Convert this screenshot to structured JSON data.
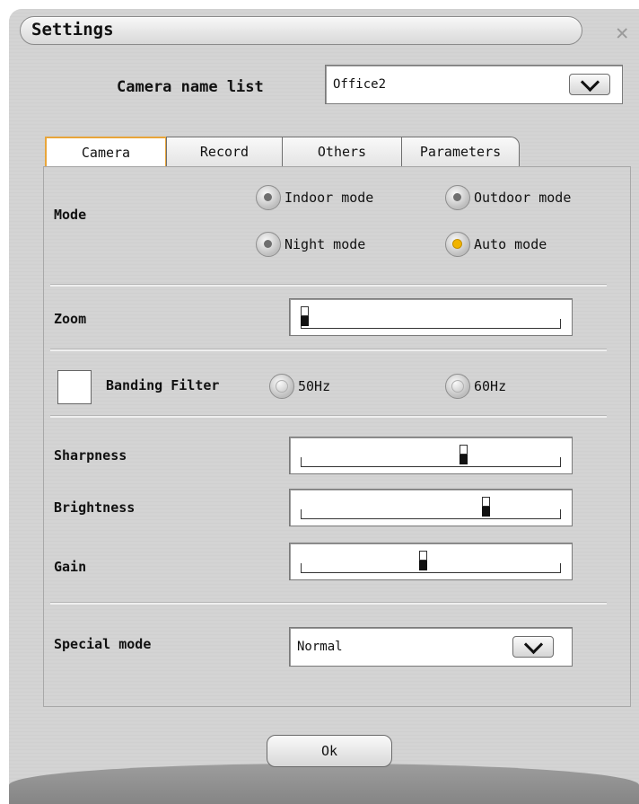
{
  "window": {
    "title": "Settings"
  },
  "camera_list": {
    "label": "Camera name list",
    "value": "Office2"
  },
  "tabs": [
    {
      "label": "Camera",
      "active": true
    },
    {
      "label": "Record",
      "active": false
    },
    {
      "label": "Others",
      "active": false
    },
    {
      "label": "Parameters",
      "active": false
    }
  ],
  "mode": {
    "label": "Mode",
    "options": [
      {
        "label": "Indoor mode",
        "selected": false
      },
      {
        "label": "Outdoor mode",
        "selected": false
      },
      {
        "label": "Night mode",
        "selected": false
      },
      {
        "label": "Auto mode",
        "selected": true
      }
    ]
  },
  "zoom": {
    "label": "Zoom",
    "value_fraction": 0.0
  },
  "banding_filter": {
    "label": "Banding Filter",
    "checked": false,
    "options": [
      {
        "label": "50Hz",
        "selected": false
      },
      {
        "label": "60Hz",
        "selected": false
      }
    ]
  },
  "sharpness": {
    "label": "Sharpness",
    "value_fraction": 0.63
  },
  "brightness": {
    "label": "Brightness",
    "value_fraction": 0.72
  },
  "gain": {
    "label": "Gain",
    "value_fraction": 0.47
  },
  "special_mode": {
    "label": "Special mode",
    "value": "Normal"
  },
  "ok": {
    "label": "Ok"
  },
  "colors": {
    "tab_active_border": "#e8a53a",
    "radio_selected": "#f1b400"
  },
  "icons": {
    "close": "close-icon",
    "dropdown": "chevron-down-icon"
  }
}
